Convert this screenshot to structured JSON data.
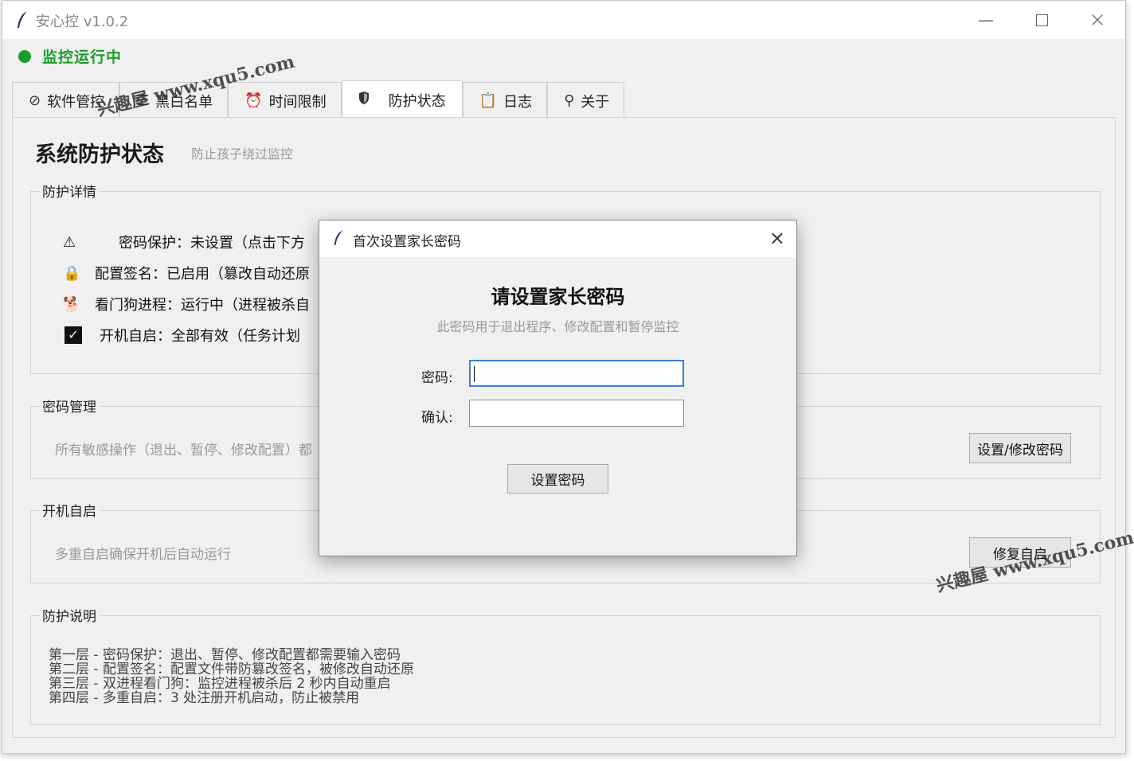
{
  "window": {
    "title": "安心控 v1.0.2",
    "status": "监控运行中",
    "status_color": "#1a9e2a"
  },
  "tabs": [
    {
      "label": "软件管控",
      "icon": "no-entry-icon"
    },
    {
      "label": "黑白名单",
      "icon": "list-icon"
    },
    {
      "label": "时间限制",
      "icon": "alarm-clock-icon"
    },
    {
      "label": "防护状态",
      "icon": "shield-icon",
      "active": true
    },
    {
      "label": "日志",
      "icon": "clipboard-icon"
    },
    {
      "label": "关于",
      "icon": "pin-icon"
    }
  ],
  "page": {
    "title": "系统防护状态",
    "subtitle": "防止孩子绕过监控"
  },
  "details": {
    "label": "防护详情",
    "items": [
      {
        "icon": "warning-icon",
        "text": "密码保护：未设置（点击下方"
      },
      {
        "icon": "lock-icon",
        "text": "配置签名：已启用（篡改自动还原"
      },
      {
        "icon": "dog-icon",
        "text": "看门狗进程：运行中（进程被杀自"
      },
      {
        "icon": "checkbox-icon",
        "text": "开机自启：全部有效（任务计划"
      }
    ]
  },
  "password_mgmt": {
    "label": "密码管理",
    "desc": "所有敏感操作（退出、暂停、修改配置）都",
    "button": "设置/修改密码"
  },
  "autostart": {
    "label": "开机自启",
    "desc": "多重自启确保开机后自动运行",
    "button": "修复自启"
  },
  "explain": {
    "label": "防护说明",
    "lines": [
      "第一层 - 密码保护：退出、暂停、修改配置都需要输入密码",
      "第二层 - 配置签名：配置文件带防篡改签名，被修改自动还原",
      "第三层 - 双进程看门狗：监控进程被杀后 2 秒内自动重启",
      "第四层 - 多重自启：3 处注册开机启动，防止被禁用"
    ]
  },
  "dialog": {
    "title": "首次设置家长密码",
    "heading": "请设置家长密码",
    "subtitle": "此密码用于退出程序、修改配置和暂停监控",
    "password_label": "密码:",
    "confirm_label": "确认:",
    "password_value": "",
    "confirm_value": "",
    "submit": "设置密码"
  },
  "watermarks": [
    "兴趣屋 www.xqu5.com",
    "兴趣屋 www.xqu5.com"
  ]
}
